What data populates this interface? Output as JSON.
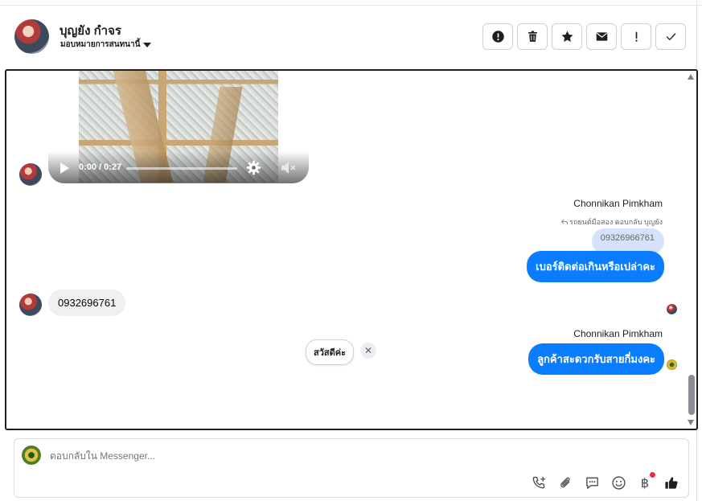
{
  "header": {
    "contact_name": "บุญยัง กำจร",
    "assign_label": "มอบหมายการสนทนานี้"
  },
  "toolbar": {
    "icons": [
      "alert-circle-icon",
      "trash-icon",
      "star-icon",
      "envelope-icon",
      "exclamation-icon",
      "check-icon"
    ]
  },
  "chat": {
    "video": {
      "time": "0:00 / 0:27"
    },
    "outgoing_1": {
      "sender": "Chonnikan Pimkham",
      "reply_note": "รถยนต์มือสอง ตอบกลับ บุญยัง",
      "quoted": "09326966761",
      "text": "เบอร์ติดต่อเกินหรือเปล่าคะ"
    },
    "incoming_1": {
      "text": "0932696761"
    },
    "outgoing_2": {
      "sender": "Chonnikan Pimkham",
      "text": "ลูกค้าสะดวกรับสายกี่มงคะ"
    },
    "quick_reply": {
      "label": "สวัสดีค่ะ",
      "close": "✕"
    }
  },
  "composer": {
    "placeholder": "ตอบกลับใน Messenger...",
    "baht_symbol": "฿",
    "icons": [
      "phone-add-icon",
      "paperclip-icon",
      "chat-bubble-icon",
      "smiley-icon",
      "baht-icon",
      "thumbs-up-icon"
    ]
  },
  "colors": {
    "accent": "#0a7cff",
    "quoted_bg": "#d4e3fb",
    "incoming_bg": "#f0f0f0",
    "notification": "#f02849"
  }
}
